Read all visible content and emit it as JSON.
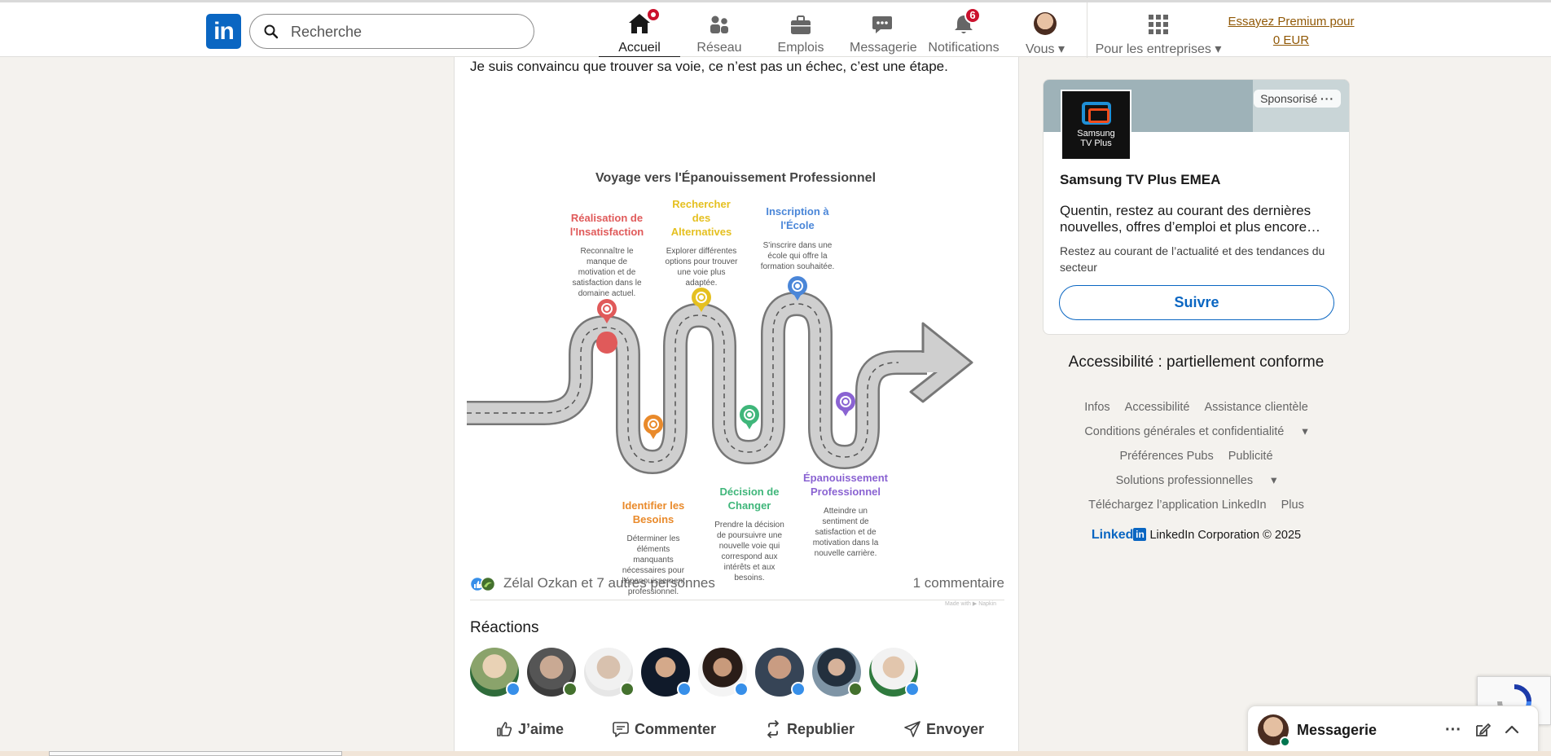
{
  "nav": {
    "logo_text": "in",
    "search_placeholder": "Recherche",
    "items": [
      {
        "label": "Accueil",
        "icon": "home-icon"
      },
      {
        "label": "Réseau",
        "icon": "network-icon"
      },
      {
        "label": "Emplois",
        "icon": "briefcase-icon"
      },
      {
        "label": "Messagerie",
        "icon": "chat-icon"
      },
      {
        "label": "Notifications",
        "icon": "bell-icon",
        "badge": "6"
      },
      {
        "label": "Vous",
        "icon": "avatar"
      }
    ],
    "business_label": "Pour les entreprises",
    "premium_line1": "Essayez Premium pour",
    "premium_line2": "0 EUR"
  },
  "post": {
    "text": "Je suis convaincu que trouver sa voie, ce n’est pas un échec, c’est une étape.",
    "infographic": {
      "title": "Voyage vers l'Épanouissement Professionnel",
      "steps": [
        {
          "title1": "Réalisation de",
          "title2": "l'Insatisfaction",
          "desc": [
            "Reconnaître le",
            "manque de",
            "motivation et de",
            "satisfaction dans le",
            "domaine actuel."
          ],
          "color": "#e05a5a"
        },
        {
          "title1": "Identifier les",
          "title2": "Besoins",
          "desc": [
            "Déterminer les",
            "éléments",
            "manquants",
            "nécessaires pour",
            "l'épanouissement",
            "professionnel."
          ],
          "color": "#e98a2b"
        },
        {
          "title1": "Rechercher",
          "title2": "des",
          "title3": "Alternatives",
          "desc": [
            "Explorer différentes",
            "options pour trouver",
            "une voie plus",
            "adaptée."
          ],
          "color": "#e5c020"
        },
        {
          "title1": "Décision de",
          "title2": "Changer",
          "desc": [
            "Prendre la décision",
            "de poursuivre une",
            "nouvelle voie qui",
            "correspond aux",
            "intérêts et aux",
            "besoins."
          ],
          "color": "#3fb67a"
        },
        {
          "title1": "Inscription à",
          "title2": "l'École",
          "desc": [
            "S'inscrire dans une",
            "école qui offre la",
            "formation souhaitée."
          ],
          "color": "#4a86d8"
        },
        {
          "title1": "Épanouissement",
          "title2": "Professionnel",
          "desc": [
            "Atteindre un",
            "sentiment de",
            "satisfaction et de",
            "motivation dans la",
            "nouvelle carrière."
          ],
          "color": "#8a63d2"
        }
      ],
      "watermark": "Made with ▶ Napkin"
    },
    "reactions_names": "Zélal Ozkan et 7 autres personnes",
    "comments_count": "1 commentaire",
    "reactions_title": "Réactions",
    "actions": {
      "like": "J’aime",
      "comment": "Commenter",
      "repost": "Republier",
      "send": "Envoyer"
    }
  },
  "ad": {
    "sponsored": "Sponsorisé",
    "logo_line1": "Samsung",
    "logo_line2": "TV Plus",
    "company": "Samsung TV Plus EMEA",
    "description": "Quentin, restez au courant des dernières nouvelles, offres d’emploi et plus encore…",
    "subtext": "Restez au courant de l’actualité et des tendances du secteur",
    "follow": "Suivre"
  },
  "footer": {
    "accessibility": "Accessibilité : partiellement conforme",
    "row1": [
      "Infos",
      "Accessibilité",
      "Assistance clientèle"
    ],
    "row2": "Conditions générales et confidentialité",
    "row3": [
      "Préférences Pubs",
      "Publicité"
    ],
    "row4": "Solutions professionnelles",
    "row5": [
      "Téléchargez l’application LinkedIn",
      "Plus"
    ],
    "brand": "Linked",
    "brand_in": "in",
    "copyright": "LinkedIn Corporation © 2025"
  },
  "messaging": {
    "title": "Messagerie"
  },
  "colors": {
    "linkedin_blue": "#0a66c2",
    "badge_red": "#cb112d",
    "premium_gold": "#915907"
  }
}
